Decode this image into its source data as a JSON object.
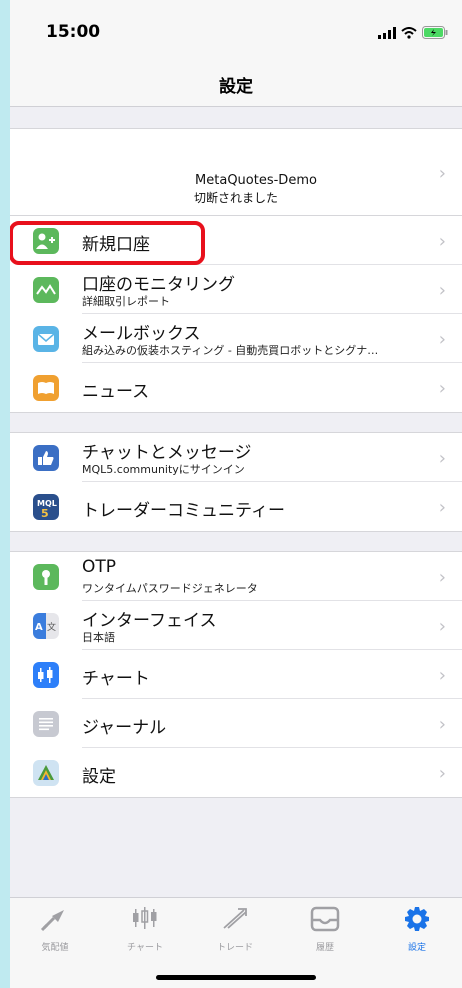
{
  "status": {
    "time": "15:00"
  },
  "nav": {
    "title": "設定"
  },
  "account": {
    "name": "MetaQuotes-Demo",
    "status": "切断されました"
  },
  "group1": [
    {
      "icon": "add-account-icon",
      "label": "新規口座",
      "sub": ""
    },
    {
      "icon": "monitoring-icon",
      "label": "口座のモニタリング",
      "sub": "詳細取引レポート"
    },
    {
      "icon": "mailbox-icon",
      "label": "メールボックス",
      "sub": "組み込みの仮装ホスティング - 自動売買ロボットとシグナ…"
    },
    {
      "icon": "news-icon",
      "label": "ニュース",
      "sub": ""
    }
  ],
  "group2": [
    {
      "icon": "chat-icon",
      "label": "チャットとメッセージ",
      "sub": "MQL5.communityにサインイン"
    },
    {
      "icon": "mql5-icon",
      "label": "トレーダーコミュニティー",
      "sub": ""
    }
  ],
  "group3": [
    {
      "icon": "otp-icon",
      "label": "OTP",
      "sub": "ワンタイムパスワードジェネレータ"
    },
    {
      "icon": "interface-icon",
      "label": "インターフェイス",
      "sub": "日本語"
    },
    {
      "icon": "chart-icon",
      "label": "チャート",
      "sub": ""
    },
    {
      "icon": "journal-icon",
      "label": "ジャーナル",
      "sub": ""
    },
    {
      "icon": "settings-app-icon",
      "label": "設定",
      "sub": ""
    }
  ],
  "tabs": [
    {
      "icon": "quotes-icon",
      "label": "気配値",
      "active": false
    },
    {
      "icon": "chart-tab-icon",
      "label": "チャート",
      "active": false
    },
    {
      "icon": "trade-icon",
      "label": "トレード",
      "active": false
    },
    {
      "icon": "history-icon",
      "label": "履歴",
      "active": false
    },
    {
      "icon": "settings-tab-icon",
      "label": "設定",
      "active": true
    }
  ],
  "colors": {
    "accent": "#1a73e8",
    "highlight": "#e8101c"
  }
}
